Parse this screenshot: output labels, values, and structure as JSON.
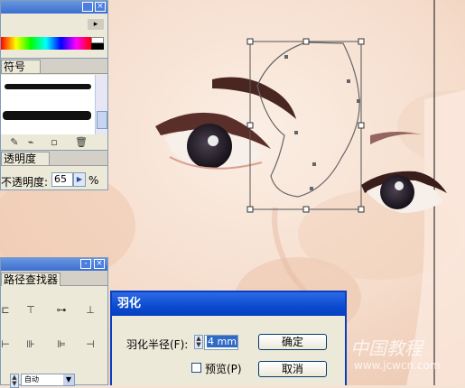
{
  "panels": {
    "swatch_panel": {
      "close_glyph": "×",
      "menu_glyph": "▸"
    },
    "symbols_panel": {
      "tab_label": "符号"
    },
    "transparency_panel": {
      "tab_label": "透明度",
      "opacity_label": "不透明度:",
      "opacity_value": "65",
      "percent_sign": "%",
      "arrow_glyph": "▶"
    },
    "pathfinder_panel": {
      "tab_label": "路径查找器",
      "minimize_glyph": "-",
      "close_glyph": "×",
      "dropdown_value": "自动"
    }
  },
  "dialog": {
    "title": "羽化",
    "radius_label": "羽化半径(F):",
    "radius_value": "4 mm",
    "preview_label": "预览(P)",
    "ok_label": "确定",
    "cancel_label": "取消"
  },
  "watermark": {
    "text_cn": "中国教程",
    "url": "www.jcwcn.com"
  },
  "colors": {
    "dialog_title_bg": "#0b4bd0",
    "panel_bg": "#ece9d8",
    "skin": "#f6e2d3",
    "selection_blue": "#316ac5"
  }
}
